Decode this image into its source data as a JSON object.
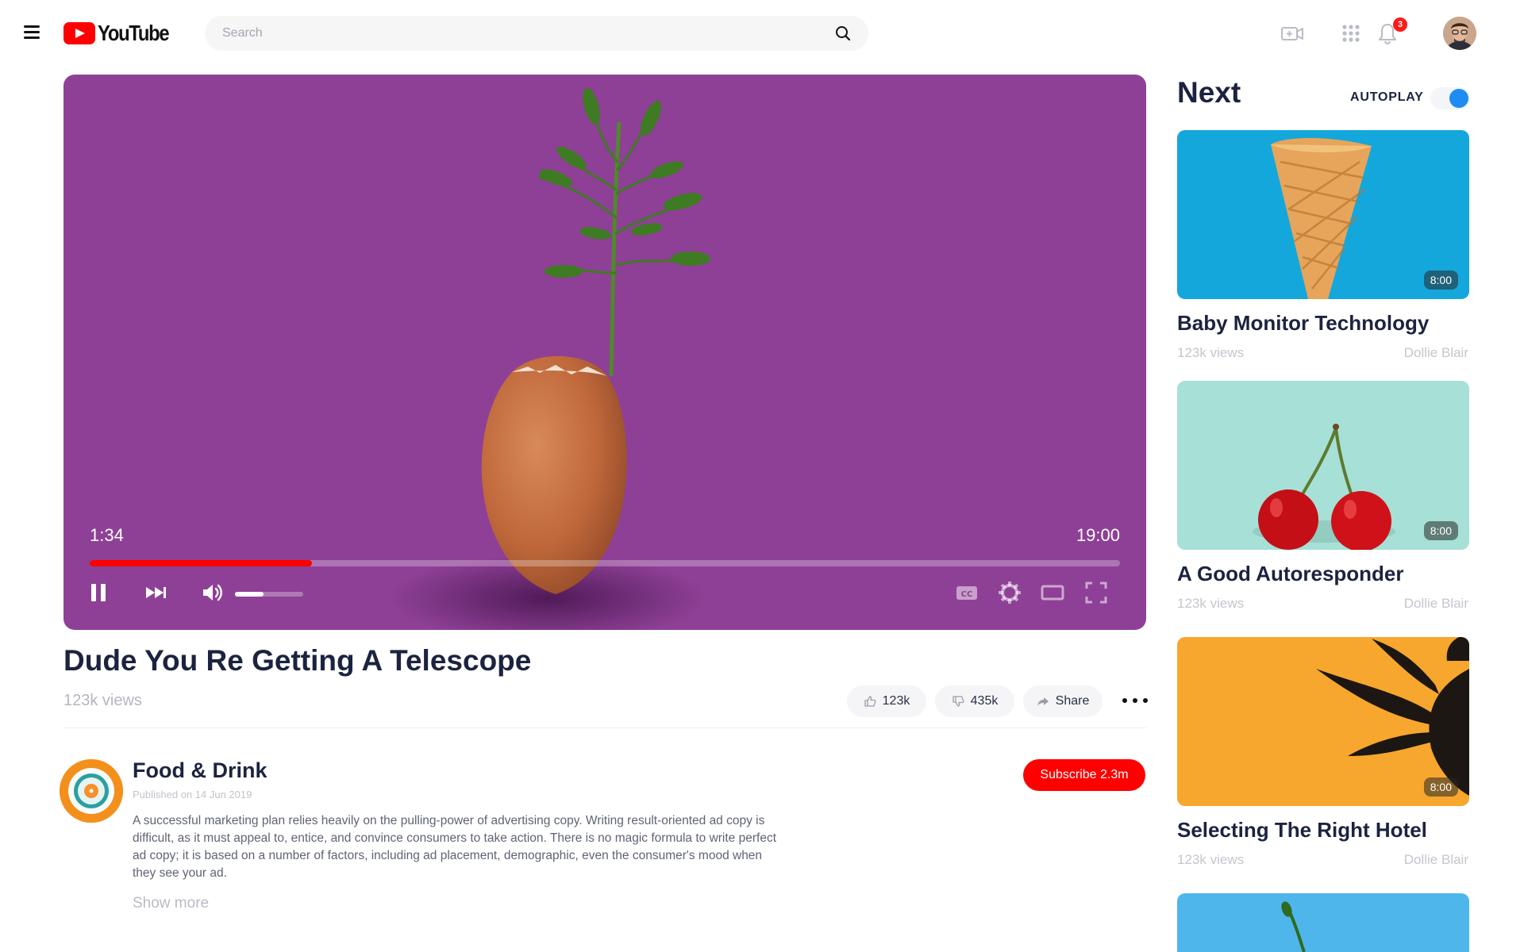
{
  "app": {
    "logo_text": "YouTube"
  },
  "search": {
    "placeholder": "Search",
    "value": ""
  },
  "header": {
    "notifications_count": "3",
    "icons": [
      "menu-icon",
      "video-camera-icon",
      "apps-grid-icon",
      "bell-icon",
      "avatar"
    ]
  },
  "player": {
    "current_time": "1:34",
    "total_time": "19:00",
    "progress": 0.216,
    "volume": 0.42,
    "background": "#8e4096",
    "controls": [
      "pause-icon",
      "skip-next-icon",
      "volume-icon",
      "captions-icon",
      "settings-gear-icon",
      "theater-mode-icon",
      "fullscreen-icon"
    ]
  },
  "video": {
    "title": "Dude You Re Getting A Telescope",
    "views": "123k views",
    "likes": "123k",
    "dislikes": "435k",
    "share_label": "Share"
  },
  "channel": {
    "name": "Food & Drink",
    "published": "Published on 14 Jun 2019",
    "description": "A successful marketing plan relies heavily on the pulling-power of advertising copy. Writing result-oriented ad copy is difficult, as it must appeal to, entice, and convince consumers to take action. There is no magic formula to write perfect ad copy; it is based on a number of factors, including ad placement, demographic, even the consumer's mood when they see your ad.",
    "show_more": "Show more",
    "subscribe_label": "Subscribe 2.3m"
  },
  "sidebar": {
    "title": "Next",
    "autoplay_label": "AUTOPLAY",
    "autoplay_on": true,
    "cards": [
      {
        "title": "Baby Monitor Technology",
        "views": "123k views",
        "channel": "Dollie Blair",
        "duration": "8:00",
        "thumb_color": "#14a7dc"
      },
      {
        "title": "A Good Autoresponder",
        "views": "123k views",
        "channel": "Dollie Blair",
        "duration": "8:00",
        "thumb_color": "#a6e0d6"
      },
      {
        "title": "Selecting The Right Hotel",
        "views": "123k views",
        "channel": "Dollie Blair",
        "duration": "8:00",
        "thumb_color": "#f7a72d"
      },
      {
        "thumb_color": "#4fb6ec"
      }
    ]
  },
  "colors": {
    "accent": "#ff0000",
    "toggle": "#1e8cf3",
    "text_dark": "#1c2340",
    "text_muted": "#c3c6cd"
  }
}
